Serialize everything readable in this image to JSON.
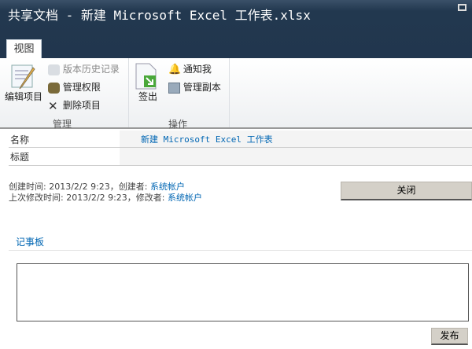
{
  "window": {
    "title": "共享文档 - 新建 Microsoft Excel 工作表.xlsx"
  },
  "ribbon": {
    "tab": "视图",
    "groups": [
      {
        "label": "管理",
        "items": {
          "edit": "编辑项目",
          "history": "版本历史记录",
          "permissions": "管理权限",
          "delete": "删除项目"
        }
      },
      {
        "label": "操作",
        "items": {
          "checkout": "签出",
          "alert": "通知我",
          "copies": "管理副本"
        }
      }
    ]
  },
  "fields": [
    {
      "label": "名称",
      "value": "新建 Microsoft Excel 工作表"
    },
    {
      "label": "标题",
      "value": ""
    }
  ],
  "meta": {
    "created_prefix": "创建时间: 2013/2/2 9:23，创建者: ",
    "created_by": "系统帐户",
    "modified_prefix": "上次修改时间: 2013/2/2 9:23，修改者: ",
    "modified_by": "系统帐户"
  },
  "close_label": "关闭",
  "notes": {
    "title": "记事板",
    "value": "",
    "post_label": "发布"
  }
}
